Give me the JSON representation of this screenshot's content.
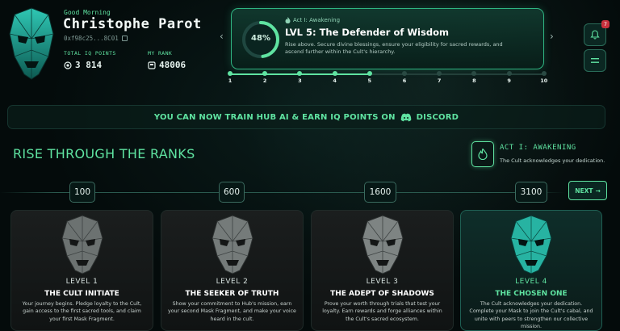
{
  "user": {
    "greeting": "Good Morning",
    "name": "Christophe Parot",
    "wallet": "0xf98c25...8C01"
  },
  "stats": {
    "iq_label": "TOTAL IQ POINTS",
    "iq_value": "3 814",
    "rank_label": "MY RANK",
    "rank_value": "48006"
  },
  "level": {
    "progress_percent": 48,
    "progress_text": "48%",
    "act": "Act I: Awakening",
    "title": "LVL 5: The Defender of Wisdom",
    "description": "Rise above. Secure divine blessings, ensure your eligibility for sacred rewards, and ascend further within the Cult's hierarchy."
  },
  "steps": [
    "1",
    "2",
    "3",
    "4",
    "5",
    "6",
    "7",
    "8",
    "9",
    "10"
  ],
  "completed_steps": 5,
  "notifications": {
    "count": "7"
  },
  "banner": {
    "text": "YOU CAN NOW TRAIN HUB AI & EARN IQ POINTS ON",
    "platform": "DISCORD"
  },
  "ranks": {
    "title": "RISE THROUGH THE RANKS",
    "act_title": "ACT I: AWAKENING",
    "act_subtitle": "The Cult acknowledges your dedication.",
    "next_label": "NEXT",
    "thresholds": [
      "100",
      "600",
      "1600",
      "3100"
    ],
    "cards": [
      {
        "level": "LEVEL 1",
        "name": "THE CULT INITIATE",
        "description": "Your journey begins. Pledge loyalty to the Cult, gain access to the first sacred tools, and claim your first Mask Fragment."
      },
      {
        "level": "LEVEL 2",
        "name": "THE SEEKER OF TRUTH",
        "description": "Show your commitment to Hub's mission, earn your second Mask Fragment, and make your voice heard in the cult."
      },
      {
        "level": "LEVEL 3",
        "name": "THE ADEPT OF SHADOWS",
        "description": "Prove your worth through trials that test your loyalty. Earn rewards and forge alliances within the Cult's sacred ecosystem."
      },
      {
        "level": "LEVEL 4",
        "name": "THE CHOSEN ONE",
        "description": "The Cult acknowledges your dedication. Complete your Mask to join the Cult's cabal, and unite with peers to strengthen our collective mission."
      }
    ]
  },
  "colors": {
    "accent": "#5fe3a1",
    "background": "#040b0b",
    "badge": "#c8313d"
  }
}
